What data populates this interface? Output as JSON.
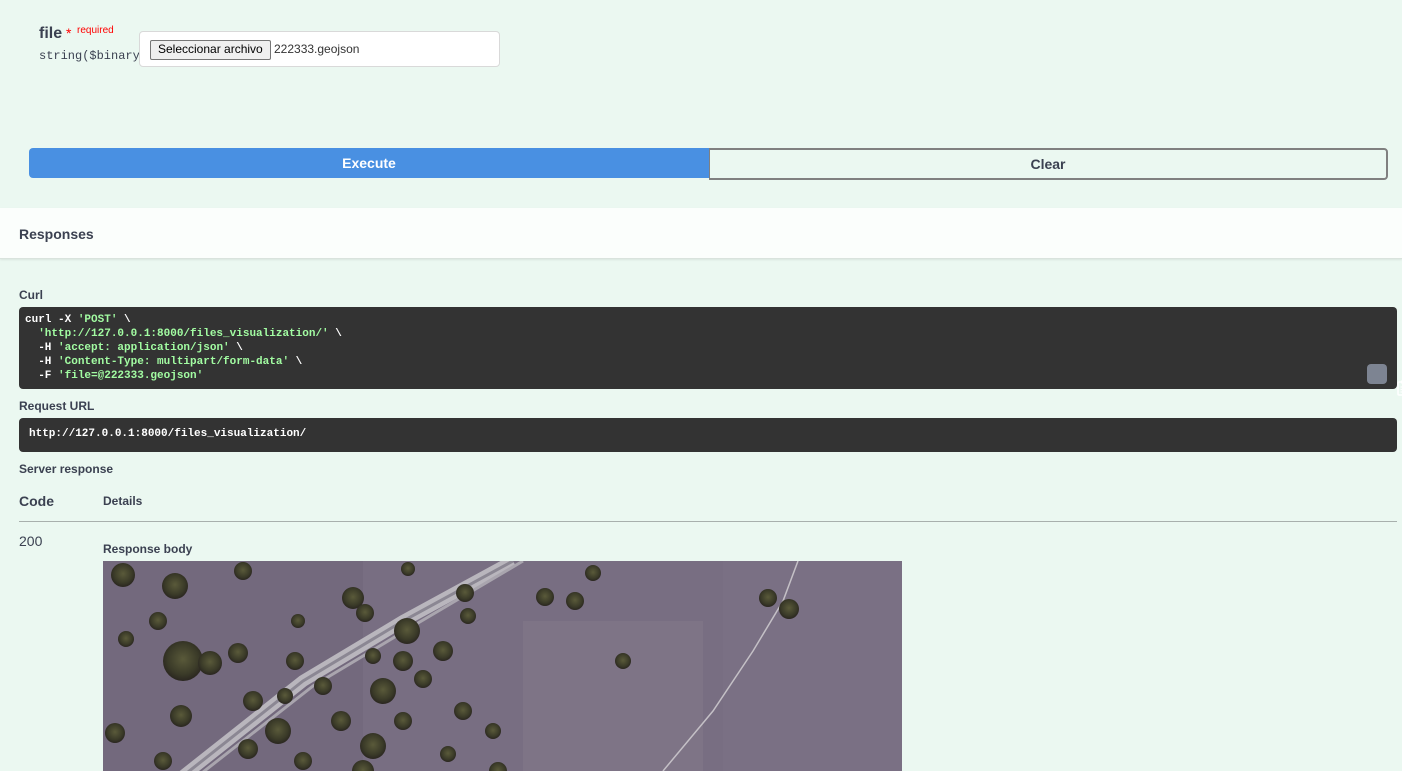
{
  "parameter": {
    "name": "file",
    "required_star": "*",
    "required_label": "required",
    "type": "string($binary)",
    "file_input": {
      "button_label": "Seleccionar archivo",
      "file_name": "222333.geojson"
    }
  },
  "actions": {
    "execute_label": "Execute",
    "clear_label": "Clear"
  },
  "responses": {
    "title": "Responses",
    "curl_label": "Curl",
    "curl_lines": {
      "l1_cmd": "curl -X ",
      "l1_str": "'POST'",
      "l1_end": " \\",
      "l2_str": "'http://127.0.0.1:8000/files_visualization/'",
      "l2_end": " \\",
      "l3_cmd": "-H ",
      "l3_str": "'accept: application/json'",
      "l3_end": " \\",
      "l4_cmd": "-H ",
      "l4_str": "'Content-Type: multipart/form-data'",
      "l4_end": " \\",
      "l5_cmd": "-F ",
      "l5_str": "'file=@222333.geojson'"
    },
    "request_url_label": "Request URL",
    "request_url": "http://127.0.0.1:8000/files_visualization/",
    "server_response_label": "Server response",
    "table_headers": {
      "code": "Code",
      "details": "Details"
    },
    "status_code": "200",
    "response_body_label": "Response body"
  },
  "colors": {
    "page_bg": "#ebf8f1",
    "execute_bg": "#4990e2",
    "code_bg": "#333333",
    "string_green": "#a2fca2",
    "required_red": "#ff0000"
  },
  "icons": [
    "copy-to-clipboard-icon"
  ]
}
